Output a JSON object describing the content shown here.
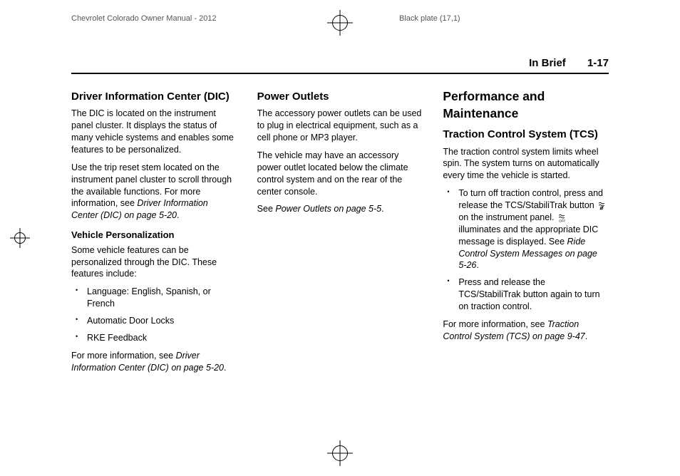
{
  "topbar": {
    "left": "Chevrolet Colorado Owner Manual - 2012",
    "right": "Black plate (17,1)"
  },
  "header": {
    "section": "In Brief",
    "page": "1-17"
  },
  "col1": {
    "h2_dic": "Driver Information Center (DIC)",
    "p1": "The DIC is located on the instrument panel cluster. It displays the status of many vehicle systems and enables some features to be personalized.",
    "p2a": "Use the trip reset stem located on the instrument panel cluster to scroll through the available functions. For more information, see ",
    "p2ref": "Driver Information Center (DIC) on page 5‑20",
    "p2b": ".",
    "h3_vp": "Vehicle Personalization",
    "p3": "Some vehicle features can be personalized through the DIC. These features include:",
    "li1": "Language: English, Spanish, or French",
    "li2": "Automatic Door Locks",
    "li3": "RKE Feedback",
    "p4a": "For more information, see ",
    "p4ref": "Driver Information Center (DIC) on page 5‑20",
    "p4b": "."
  },
  "col2": {
    "h2_po": "Power Outlets",
    "p1": "The accessory power outlets can be used to plug in electrical equipment, such as a cell phone or MP3 player.",
    "p2": "The vehicle may have an accessory power outlet located below the climate control system and on the rear of the center console.",
    "p3a": "See ",
    "p3ref": "Power Outlets on page 5‑5",
    "p3b": "."
  },
  "col3": {
    "h1_pm": "Performance and Maintenance",
    "h2_tcs": "Traction Control System (TCS)",
    "p1": "The traction control system limits wheel spin. The system turns on automatically every time the vehicle is started.",
    "li1a": "To turn off traction control, press and release the TCS/StabiliTrak button ",
    "li1b": " on the instrument panel. ",
    "li1c": " illuminates and the appropriate DIC message is displayed. See ",
    "li1ref": "Ride Control System Messages on page 5‑26",
    "li1d": ".",
    "li2": "Press and release the TCS/StabiliTrak button again to turn on traction control.",
    "p2a": "For more information, see ",
    "p2ref": "Traction Control System (TCS) on page 9‑47",
    "p2b": "."
  }
}
